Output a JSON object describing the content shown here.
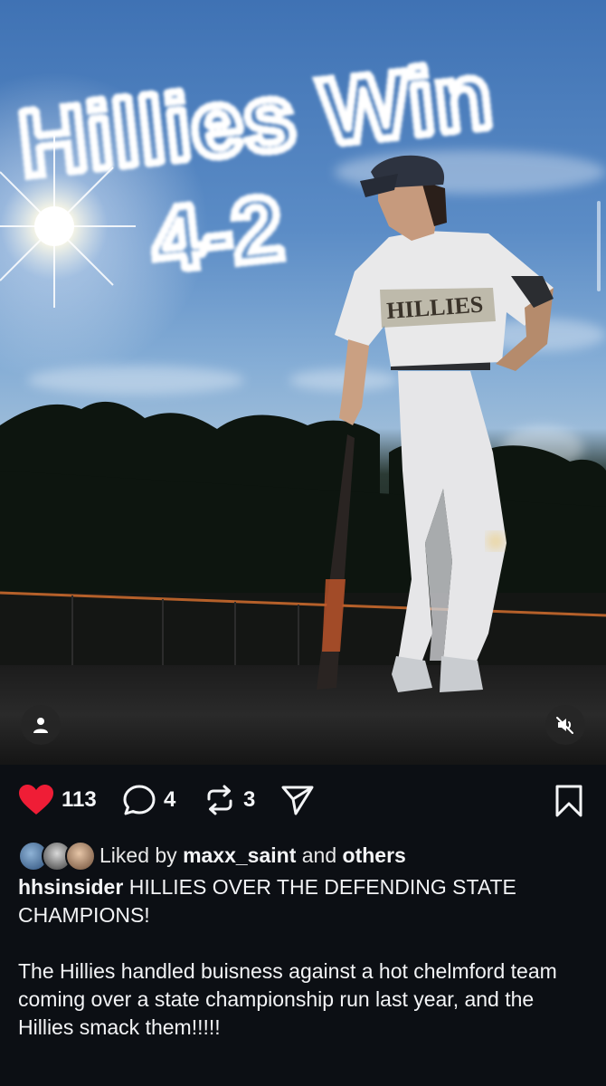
{
  "post_image": {
    "sky_text_line1": "Hillies Win",
    "sky_text_line2": "4-2",
    "jersey_text": "HILLIES"
  },
  "media_controls": {
    "user_tag_icon": "person-icon",
    "mute_icon": "speaker-muted-icon"
  },
  "actions": {
    "likes": "113",
    "comments": "4",
    "reposts": "3",
    "like_color": "#ef1d36"
  },
  "liked_by": {
    "prefix": "Liked by",
    "user": "maxx_saint",
    "conjunction": "and",
    "others": "others"
  },
  "caption": {
    "username": "hhsinsider",
    "headline": "HILLIES OVER THE DEFENDING STATE CHAMPIONS!",
    "body": "The Hillies handled buisness against a hot chelmford team coming over a state championship run last year, and the Hillies smack them!!!!!"
  }
}
